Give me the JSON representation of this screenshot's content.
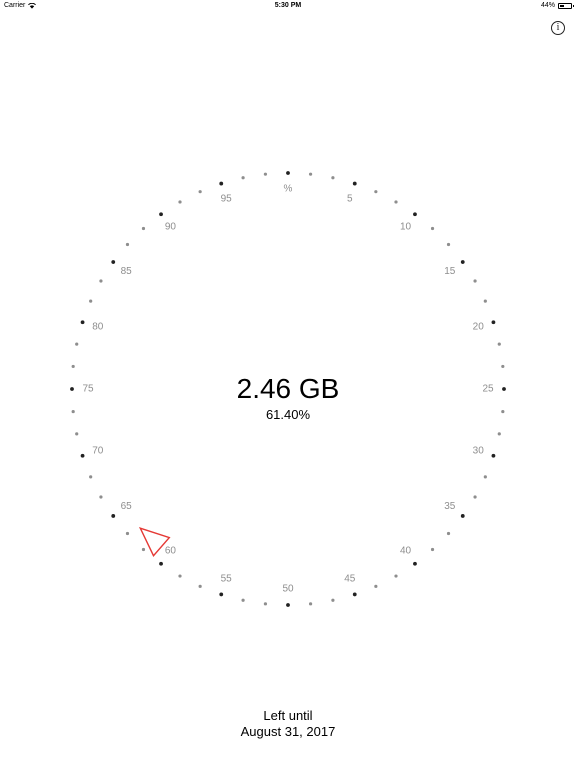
{
  "status_bar": {
    "carrier": "Carrier",
    "time": "5:30 PM",
    "battery": "44%",
    "battery_level": 0.44
  },
  "info_button": {
    "label": "i",
    "icon": "info-icon"
  },
  "dial": {
    "labels": [
      "%",
      "5",
      "10",
      "15",
      "20",
      "25",
      "30",
      "35",
      "40",
      "45",
      "50",
      "55",
      "60",
      "65",
      "70",
      "75",
      "80",
      "85",
      "90",
      "95"
    ],
    "major_dot_color": "#222222",
    "minor_dot_color": "#8e8e8e",
    "indicator_color": "#e53935",
    "indicator_percent": 61.4
  },
  "usage": {
    "value": "2.46 GB",
    "percent": "61.40%"
  },
  "footer": {
    "line1": "Left until",
    "line2": "August 31, 2017"
  }
}
